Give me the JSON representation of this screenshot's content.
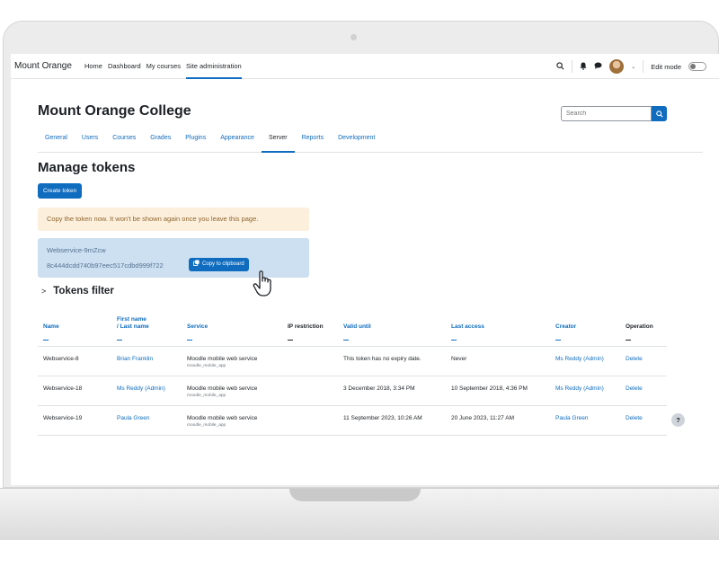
{
  "navbar": {
    "brand": "Mount Orange",
    "links": [
      "Home",
      "Dashboard",
      "My courses",
      "Site administration"
    ],
    "edit_mode_label": "Edit mode"
  },
  "header": {
    "site_title": "Mount Orange College",
    "search_placeholder": "Search",
    "tabs": [
      "General",
      "Users",
      "Courses",
      "Grades",
      "Plugins",
      "Appearance",
      "Server",
      "Reports",
      "Development"
    ],
    "active_tab": "Server"
  },
  "main": {
    "heading": "Manage tokens",
    "create_label": "Create token",
    "warning": "Copy the token now. It won't be shown again once you leave this page.",
    "token_name": "Webservice-9mZcw",
    "token_value": "8c444dcdd740b97eec517cdbd999f722",
    "copy_label": "Copy to clipboard",
    "filter_heading": "Tokens filter"
  },
  "table": {
    "headers": {
      "name": "Name",
      "first_name": "First name",
      "last_name": "/ Last name",
      "service": "Service",
      "ip": "IP restriction",
      "valid": "Valid until",
      "access": "Last access",
      "creator": "Creator",
      "operation": "Operation"
    },
    "rows": [
      {
        "name": "Webservice-8",
        "user": "Brian Franklin",
        "service": "Moodle mobile web service",
        "shortname": "moodle_mobile_app",
        "ip": "",
        "valid": "This token has no expiry date.",
        "access": "Never",
        "creator": "Ms Reddy (Admin)",
        "op": "Delete"
      },
      {
        "name": "Webservice-18",
        "user": "Ms Reddy (Admin)",
        "service": "Moodle mobile web service",
        "shortname": "moodle_mobile_app",
        "ip": "",
        "valid": "3 December 2018, 3:34 PM",
        "access": "10 September 2018, 4:36 PM",
        "creator": "Ms Reddy (Admin)",
        "op": "Delete"
      },
      {
        "name": "Webservice-19",
        "user": "Paula Green",
        "service": "Moodle mobile web service",
        "shortname": "moodle_mobile_app",
        "ip": "",
        "valid": "11 September 2023, 10:26 AM",
        "access": "20 June 2023, 11:27 AM",
        "creator": "Paula Green",
        "op": "Delete"
      }
    ]
  },
  "help_label": "?",
  "colors": {
    "primary": "#0f6cbf",
    "warning_bg": "#fcefdc",
    "info_bg": "#cce0f2"
  }
}
